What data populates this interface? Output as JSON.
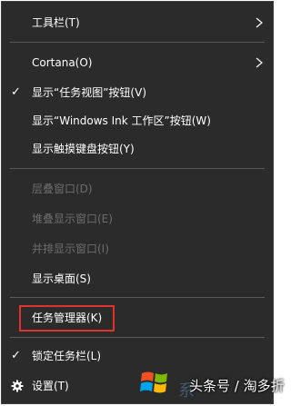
{
  "menu": {
    "items": [
      {
        "label": "工具栏(T)",
        "checked": false,
        "submenu": true,
        "disabled": false
      },
      {
        "label": "Cortana(O)",
        "checked": false,
        "submenu": true,
        "disabled": false
      },
      {
        "label": "显示“任务视图”按钮(V)",
        "checked": true,
        "submenu": false,
        "disabled": false
      },
      {
        "label": "显示“Windows Ink 工作区”按钮(W)",
        "checked": false,
        "submenu": false,
        "disabled": false
      },
      {
        "label": "显示触摸键盘按钮(Y)",
        "checked": false,
        "submenu": false,
        "disabled": false
      },
      {
        "label": "层叠窗口(D)",
        "checked": false,
        "submenu": false,
        "disabled": true
      },
      {
        "label": "堆叠显示窗口(E)",
        "checked": false,
        "submenu": false,
        "disabled": true
      },
      {
        "label": "并排显示窗口(I)",
        "checked": false,
        "submenu": false,
        "disabled": true
      },
      {
        "label": "显示桌面(S)",
        "checked": false,
        "submenu": false,
        "disabled": false
      },
      {
        "label": "任务管理器(K)",
        "checked": false,
        "submenu": false,
        "disabled": false,
        "highlighted": true
      },
      {
        "label": "锁定任务栏(L)",
        "checked": true,
        "submenu": false,
        "disabled": false
      },
      {
        "label": "设置(T)",
        "checked": false,
        "submenu": false,
        "disabled": false,
        "icon": "gear-icon"
      }
    ],
    "check_glyph": "✓",
    "highlight_color": "#e2322d",
    "background_color": "#2b2b2b",
    "disabled_color": "#6d6d6d"
  },
  "watermark": {
    "text": "头条号 / 淘多折"
  }
}
